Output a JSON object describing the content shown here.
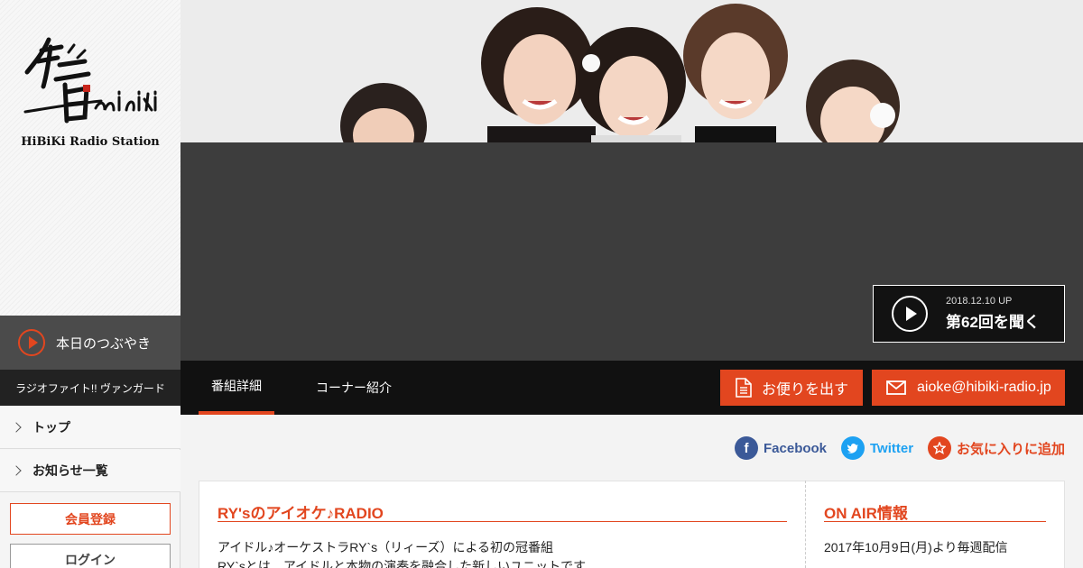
{
  "sidebar": {
    "logo_caption": "HiBiKi Radio Station",
    "tsubuyaki_label": "本日のつぶやき",
    "program_name": "ラジオファイト!! ヴァンガード",
    "nav": [
      {
        "label": "トップ"
      },
      {
        "label": "お知らせ一覧"
      }
    ],
    "register_label": "会員登録",
    "login_label": "ログイン"
  },
  "player": {
    "upload_date": "2018.12.10 UP",
    "listen_label": "第62回を聞く"
  },
  "tabs": [
    {
      "label": "番組詳細",
      "active": true
    },
    {
      "label": "コーナー紹介",
      "active": false
    }
  ],
  "actions": {
    "letter_label": "お便りを出す",
    "email_label": "aioke@hibiki-radio.jp"
  },
  "social": {
    "facebook_label": "Facebook",
    "twitter_label": "Twitter",
    "favorite_label": "お気に入りに追加"
  },
  "program": {
    "title": "RY'sのアイオケ♪RADIO",
    "line1": "アイドル♪オーケストラRY`s（リィーズ）による初の冠番組",
    "line2": "RY`sとは、アイドルと本物の演奏を融合した新しいユニットです"
  },
  "onair": {
    "title": "ON AIR情報",
    "schedule": "2017年10月9日(月)より毎週配信"
  },
  "colors": {
    "accent": "#e2461f",
    "facebook": "#3b5998",
    "twitter": "#1da1f2",
    "dark": "#111111"
  }
}
